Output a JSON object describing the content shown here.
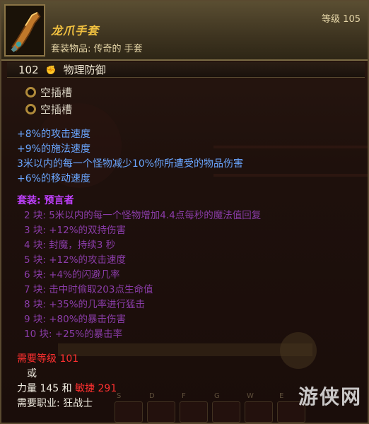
{
  "item": {
    "name": "龙爪手套",
    "type": "套装物品: 传奇的 手套",
    "level": "等级 105"
  },
  "defense": {
    "value": "102",
    "label": "物理防御"
  },
  "sockets": [
    "空插槽",
    "空插槽"
  ],
  "affixes": [
    "+8%的攻击速度",
    "+9%的施法速度",
    "3米以内的每一个怪物减少10%你所遭受的物品伤害",
    "+6%的移动速度"
  ],
  "set": {
    "label": "套装",
    "name": "预言者",
    "bonuses": [
      "2 块: 5米以内的每一个怪物增加4.4点每秒的魔法值回复",
      "3 块: +12%的双持伤害",
      "4 块: 封魔，持续3 秒",
      "5 块: +12%的攻击速度",
      "6 块: +4%的闪避几率",
      "7 块: 击中时偷取203点生命值",
      "8 块: +35%的几率进行猛击",
      "9 块: +80%的暴击伤害",
      "10 块: +25%的暴击率"
    ]
  },
  "requirements": {
    "level": "需要等级 101",
    "or": "或",
    "strength_prefix": "力量 145 和",
    "agility": "敏捷 291",
    "class": "需要职业: 狂战士"
  },
  "skill_keys": [
    "S",
    "D",
    "F",
    "G",
    "W",
    "E"
  ],
  "watermark": "游侠网",
  "colors": {
    "item_name": "#f0c040",
    "magic_affix": "#6aa6ff",
    "set": "#c040ff",
    "requirement_red": "#ff3030"
  }
}
